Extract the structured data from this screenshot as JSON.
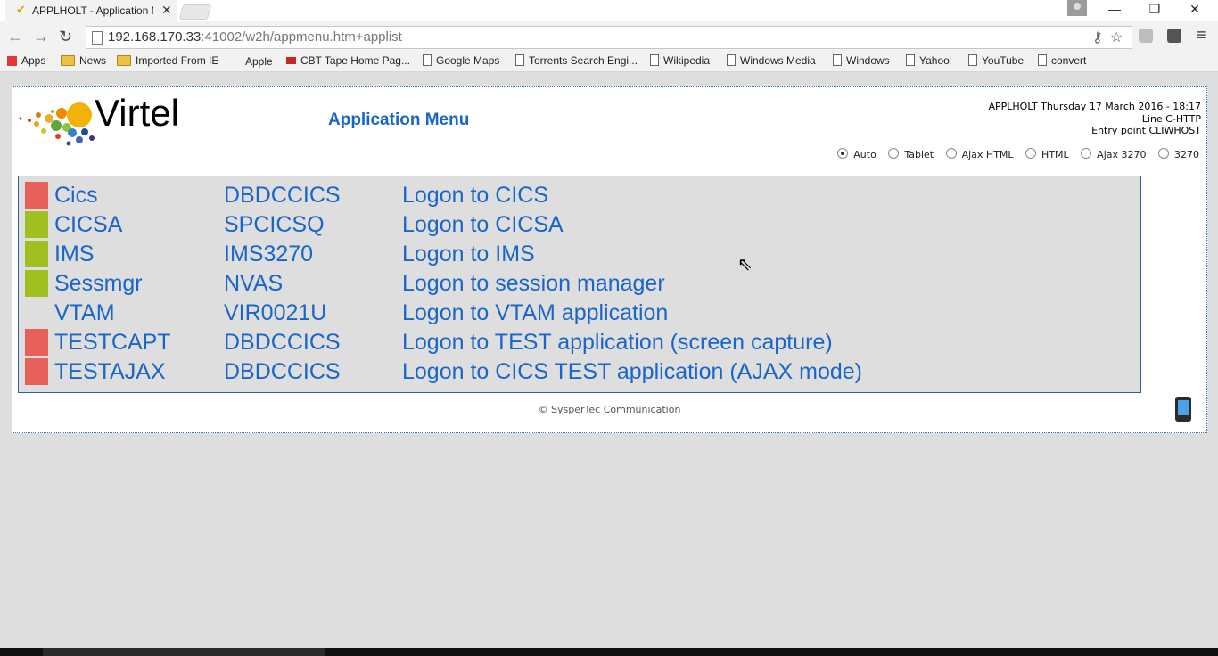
{
  "browser": {
    "tab_title": "APPLHOLT - Application M",
    "tab_close": "✕",
    "window_controls": {
      "minimize": "—",
      "restore": "❐",
      "close": "✕"
    },
    "nav": {
      "back": "←",
      "forward": "→",
      "reload": "↻"
    },
    "url_host": "192.168.170.33",
    "url_rest": ":41002/w2h/appmenu.htm+applist",
    "menu": "≡"
  },
  "bookmarks": [
    {
      "label": "Apps",
      "icon": "apps-grid-icon"
    },
    {
      "label": "News",
      "icon": "folder-icon"
    },
    {
      "label": "Imported From IE",
      "icon": "folder-icon"
    },
    {
      "label": "Apple",
      "icon": "apple-icon"
    },
    {
      "label": "CBT Tape Home Pag...",
      "icon": "cbt-icon"
    },
    {
      "label": "Google Maps",
      "icon": "page-icon"
    },
    {
      "label": "Torrents Search Engi...",
      "icon": "page-icon"
    },
    {
      "label": "Wikipedia",
      "icon": "page-icon"
    },
    {
      "label": "Windows Media",
      "icon": "page-icon"
    },
    {
      "label": "Windows",
      "icon": "page-icon"
    },
    {
      "label": "Yahoo!",
      "icon": "page-icon"
    },
    {
      "label": "YouTube",
      "icon": "page-icon"
    },
    {
      "label": "convert",
      "icon": "page-icon"
    }
  ],
  "header": {
    "logo_text": "Virtel",
    "title": "Application Menu",
    "info_line1": "APPLHOLT Thursday 17 March 2016 - 18:17",
    "info_line2": "Line C-HTTP",
    "info_line3": "Entry point CLIWHOST"
  },
  "modes": [
    {
      "label": "Auto",
      "selected": true
    },
    {
      "label": "Tablet",
      "selected": false
    },
    {
      "label": "Ajax HTML",
      "selected": false
    },
    {
      "label": "HTML",
      "selected": false
    },
    {
      "label": "Ajax 3270",
      "selected": false
    },
    {
      "label": "3270",
      "selected": false
    }
  ],
  "applications": [
    {
      "name": "Cics",
      "appl": "DBDCCICS",
      "description": "Logon to CICS",
      "status_color": "#e8605a"
    },
    {
      "name": "CICSA",
      "appl": "SPCICSQ",
      "description": "Logon to CICSA",
      "status_color": "#a0c020"
    },
    {
      "name": "IMS",
      "appl": "IMS3270",
      "description": "Logon to IMS",
      "status_color": "#a0c020"
    },
    {
      "name": "Sessmgr",
      "appl": "NVAS",
      "description": "Logon to session manager",
      "status_color": "#a0c020"
    },
    {
      "name": "VTAM",
      "appl": "VIR0021U",
      "description": "Logon to VTAM application",
      "status_color": ""
    },
    {
      "name": "TESTCAPT",
      "appl": "DBDCCICS",
      "description": "Logon to TEST application (screen capture)",
      "status_color": "#e8605a"
    },
    {
      "name": "TESTAJAX",
      "appl": "DBDCCICS",
      "description": "Logon to CICS TEST application (AJAX mode)",
      "status_color": "#e8605a"
    }
  ],
  "footer": {
    "copyright": "© SysperTec Communication"
  },
  "colors": {
    "link": "#1a66c8",
    "status_up": "#a0c020",
    "status_down": "#e8605a",
    "border": "#2a5fa8"
  }
}
